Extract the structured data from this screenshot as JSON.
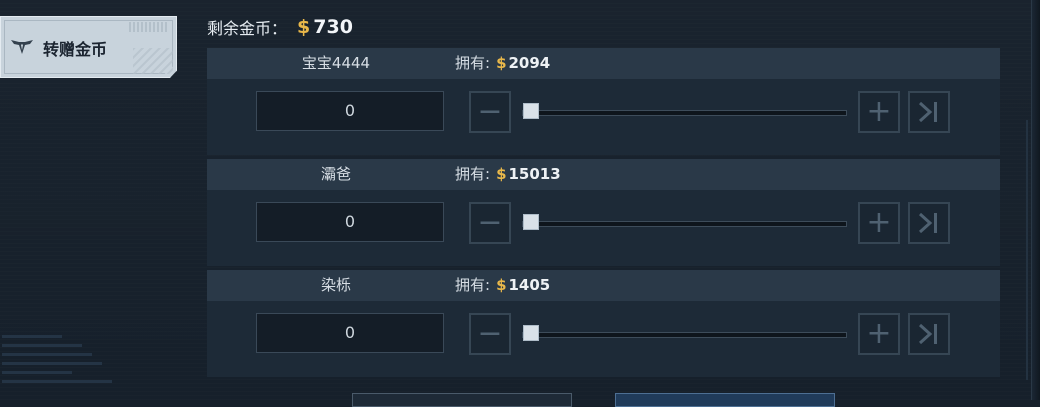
{
  "side_tab": {
    "label": "转赠金币",
    "icon": "wings-emblem-icon"
  },
  "balance": {
    "label": "剩余金币：",
    "currency_symbol": "$",
    "amount": "730"
  },
  "owned_label": "拥有:",
  "currency_symbol": "$",
  "players": [
    {
      "name": "宝宝4444",
      "owned": "2094",
      "gift_amount": "0",
      "slider_fraction": 0
    },
    {
      "name": "灞爸",
      "owned": "15013",
      "gift_amount": "0",
      "slider_fraction": 0
    },
    {
      "name": "染栎",
      "owned": "1405",
      "gift_amount": "0",
      "slider_fraction": 0
    }
  ],
  "controls": {
    "minus_icon": "minus-icon",
    "plus_icon": "plus-icon",
    "max_icon": "max-skip-icon"
  },
  "colors": {
    "coin": "#e9b84a",
    "panel": "#1d2a37",
    "panel_header": "#2a3948",
    "background": "#16202b"
  }
}
